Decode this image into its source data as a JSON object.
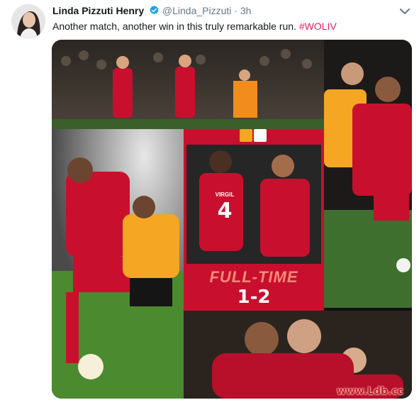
{
  "tweet": {
    "display_name": "Linda Pizzuti Henry",
    "handle": "@Linda_Pizzuti",
    "separator": "·",
    "timestamp": "3h",
    "text": "Another match, another win in this truly remarkable run.",
    "hashtag": "#WOLIV"
  },
  "media": {
    "graphic": {
      "full_time_label": "FULL-TIME",
      "score": "1-2",
      "shirt_name": "VIRGIL",
      "shirt_number": "4"
    },
    "watermark": "www.Ldb.cc"
  },
  "colors": {
    "liverpool_red": "#c8102e",
    "wolves_gold": "#f5a623",
    "verified_blue": "#1da1f2",
    "hashtag": "#e0245e"
  },
  "icons": {
    "verified": "verified-badge-icon",
    "menu": "chevron-down-icon"
  }
}
